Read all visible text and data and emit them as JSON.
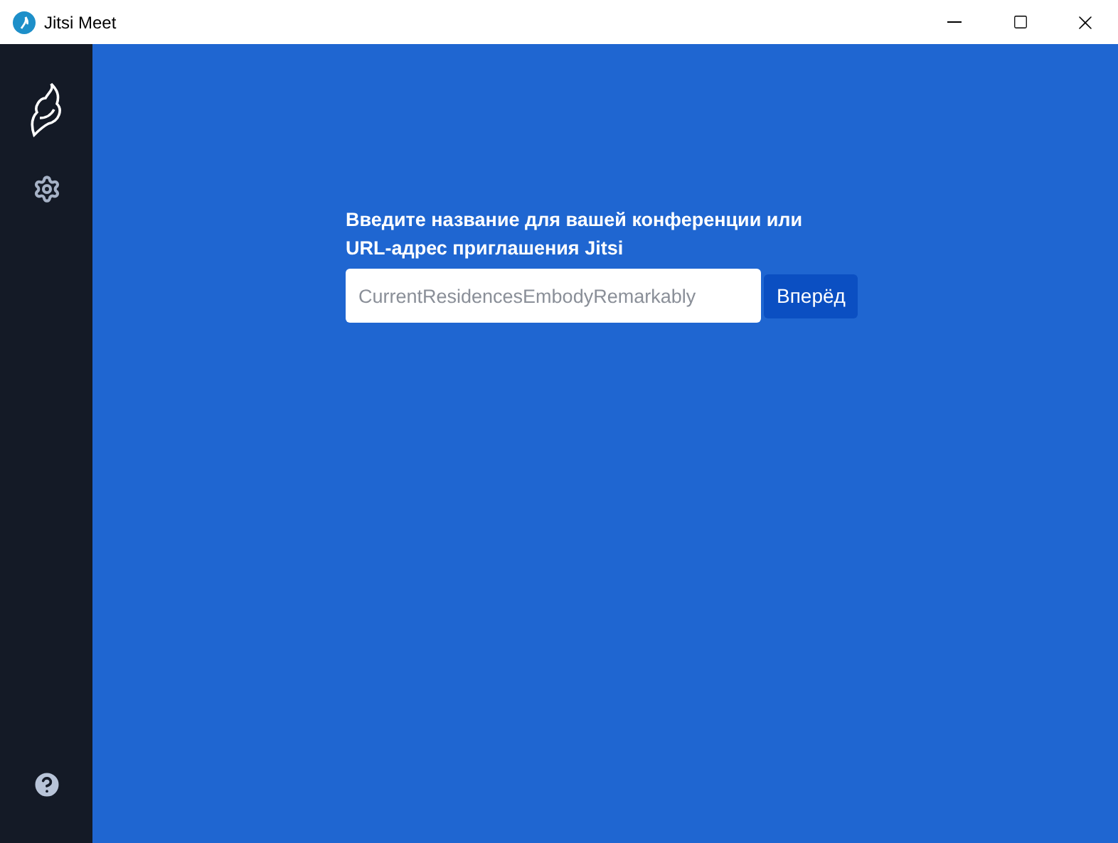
{
  "window": {
    "title": "Jitsi Meet"
  },
  "form": {
    "label": "Введите название для вашей конференции или URL-адрес приглашения Jitsi",
    "placeholder": "CurrentResidencesEmbodyRemarkably",
    "button": "Вперёд"
  }
}
